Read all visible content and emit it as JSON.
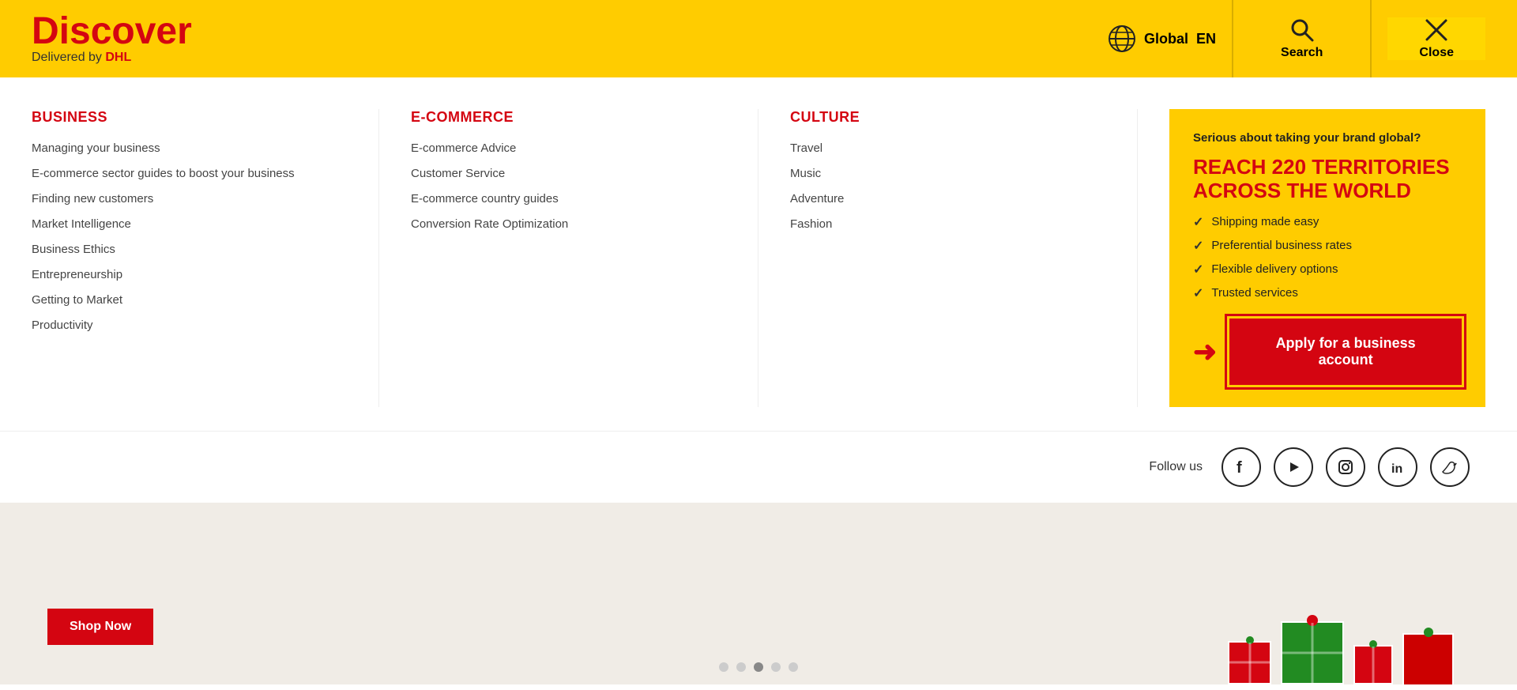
{
  "header": {
    "logo": {
      "discover": "Discover",
      "delivered": "Delivered by ",
      "dhl": "DHL"
    },
    "globe_label": "Global",
    "lang": "EN",
    "search_label": "Search",
    "close_label": "Close"
  },
  "nav": {
    "columns": [
      {
        "id": "business",
        "title": "BUSINESS",
        "items": [
          "Managing your business",
          "E-commerce sector guides to boost your business",
          "Finding new customers",
          "Market Intelligence",
          "Business Ethics",
          "Entrepreneurship",
          "Getting to Market",
          "Productivity"
        ]
      },
      {
        "id": "ecommerce",
        "title": "E-COMMERCE",
        "items": [
          "E-commerce Advice",
          "Customer Service",
          "E-commerce country guides",
          "Conversion Rate Optimization"
        ]
      },
      {
        "id": "culture",
        "title": "CULTURE",
        "items": [
          "Travel",
          "Music",
          "Adventure",
          "Fashion"
        ]
      }
    ]
  },
  "promo": {
    "serious": "Serious about taking your brand global?",
    "headline": "REACH 220 TERRITORIES\nACROSS THE WORLD",
    "checklist": [
      "Shipping made easy",
      "Preferential business rates",
      "Flexible delivery options",
      "Trusted services"
    ],
    "cta_label": "Apply for a business account"
  },
  "social": {
    "follow_label": "Follow us",
    "icons": [
      "facebook",
      "youtube",
      "instagram",
      "linkedin",
      "twitter"
    ]
  },
  "slider": {
    "dots": [
      false,
      false,
      true,
      false,
      false
    ]
  }
}
